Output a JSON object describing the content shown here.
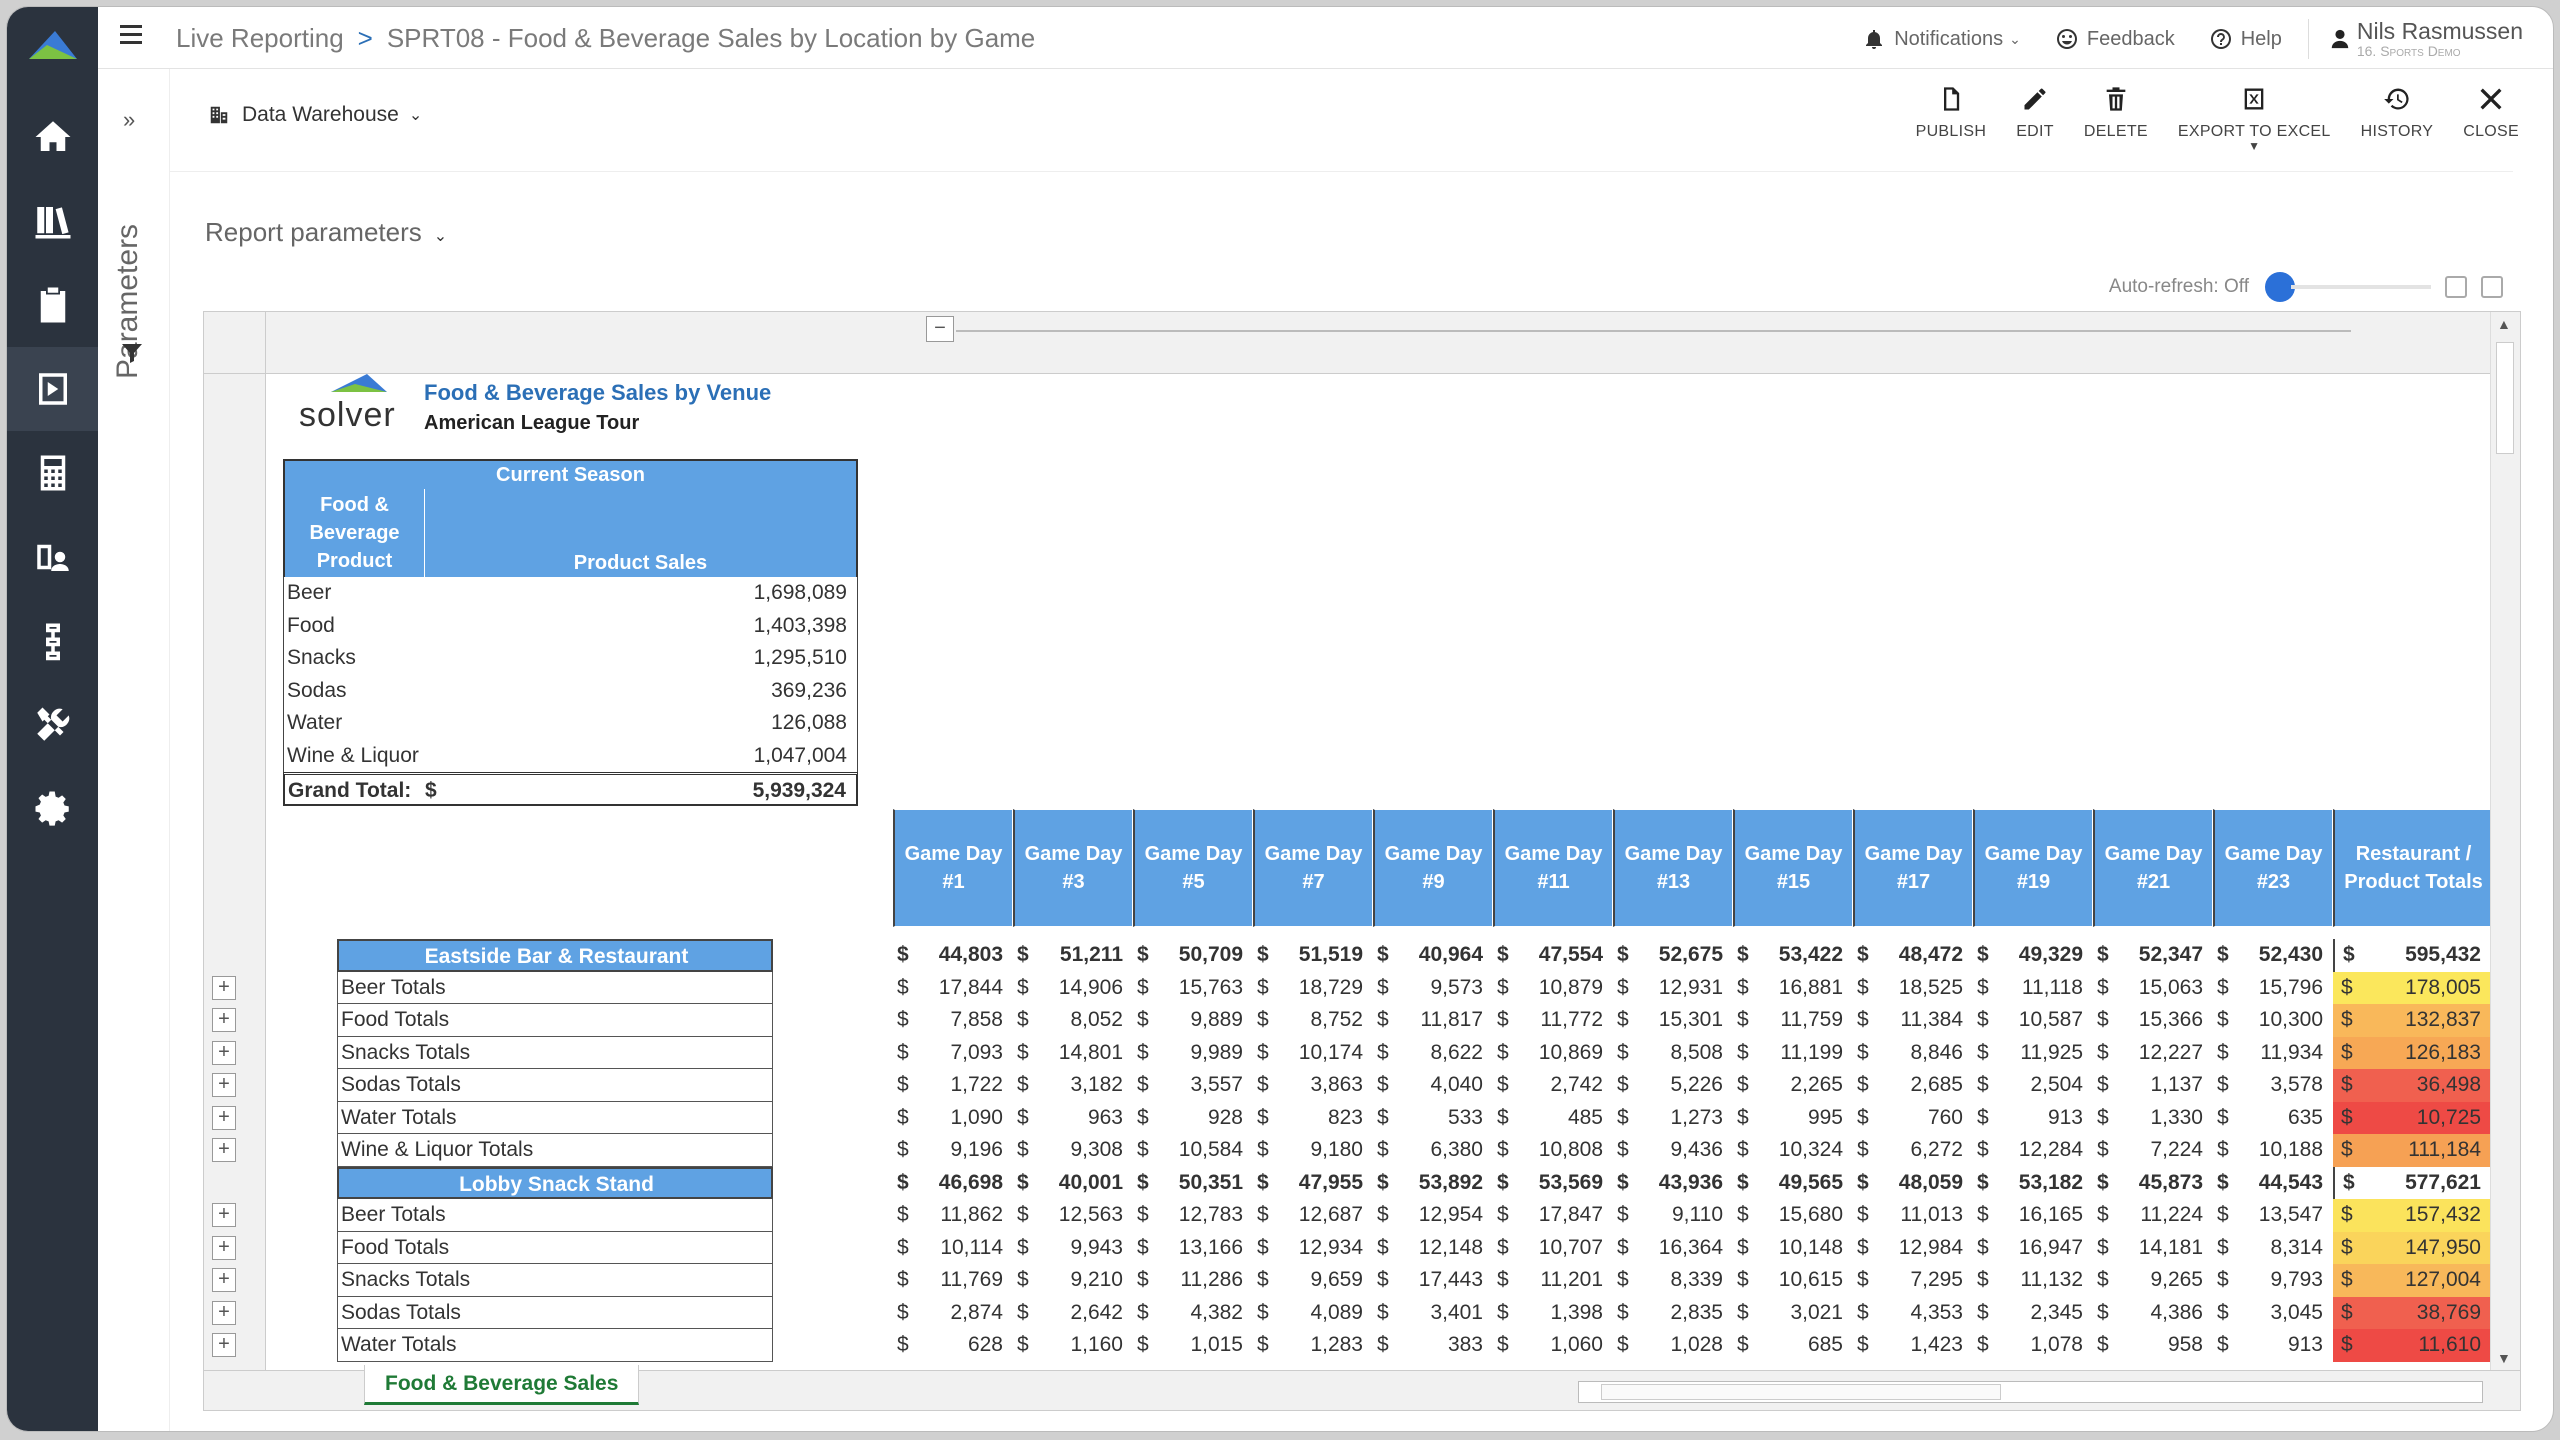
{
  "breadcrumb": {
    "root": "Live Reporting",
    "sep": ">",
    "current": "SPRT08 - Food & Beverage Sales by Location by Game"
  },
  "topbar": {
    "notifications": "Notifications",
    "feedback": "Feedback",
    "help": "Help",
    "user_name": "Nils Rasmussen",
    "user_org": "16. Sports Demo"
  },
  "param_panel": {
    "label": "Parameters",
    "expand": "»"
  },
  "data_source": {
    "label": "Data Warehouse"
  },
  "toolbar": {
    "publish": "PUBLISH",
    "edit": "EDIT",
    "delete": "DELETE",
    "export": "EXPORT TO EXCEL",
    "history": "HISTORY",
    "close": "CLOSE"
  },
  "report_params": {
    "label": "Report parameters"
  },
  "auto_refresh": {
    "label": "Auto-refresh: Off"
  },
  "report": {
    "logo_text": "solver",
    "title": "Food & Beverage Sales by Venue",
    "subtitle": "American League Tour",
    "season_header": "Current Season",
    "col_product": "Food & Beverage Product",
    "col_sales": "Product Sales",
    "products": [
      {
        "name": "Beer",
        "sales": "1,698,089"
      },
      {
        "name": "Food",
        "sales": "1,403,398"
      },
      {
        "name": "Snacks",
        "sales": "1,295,510"
      },
      {
        "name": "Sodas",
        "sales": "369,236"
      },
      {
        "name": "Water",
        "sales": "126,088"
      },
      {
        "name": "Wine & Liquor",
        "sales": "1,047,004"
      }
    ],
    "grand_total_label": "Grand Total:",
    "grand_total_currency": "$",
    "grand_total": "5,939,324",
    "game_days": [
      "Game Day #1",
      "Game Day #3",
      "Game Day #5",
      "Game Day #7",
      "Game Day #9",
      "Game Day #11",
      "Game Day #13",
      "Game Day #15",
      "Game Day #17",
      "Game Day #19",
      "Game Day #21",
      "Game Day #23"
    ],
    "totals_header": "Restaurant / Product Totals",
    "currency": "$",
    "venues": [
      {
        "name": "Eastside Bar & Restaurant",
        "values": [
          "44,803",
          "51,211",
          "50,709",
          "51,519",
          "40,964",
          "47,554",
          "52,675",
          "53,422",
          "48,472",
          "49,329",
          "52,347",
          "52,430"
        ],
        "total": "595,432",
        "rows": [
          {
            "label": "Beer Totals",
            "values": [
              "17,844",
              "14,906",
              "15,763",
              "18,729",
              "9,573",
              "10,879",
              "12,931",
              "16,881",
              "18,525",
              "11,118",
              "15,063",
              "15,796"
            ],
            "total": "178,005",
            "color": "#fbe75c"
          },
          {
            "label": "Food Totals",
            "values": [
              "7,858",
              "8,052",
              "9,889",
              "8,752",
              "11,817",
              "11,772",
              "15,301",
              "11,759",
              "11,384",
              "10,587",
              "15,366",
              "10,300"
            ],
            "total": "132,837",
            "color": "#f9b85a"
          },
          {
            "label": "Snacks Totals",
            "values": [
              "7,093",
              "14,801",
              "9,989",
              "10,174",
              "8,622",
              "10,869",
              "8,508",
              "11,199",
              "8,846",
              "11,925",
              "12,227",
              "11,934"
            ],
            "total": "126,183",
            "color": "#f7a855"
          },
          {
            "label": "Sodas Totals",
            "values": [
              "1,722",
              "3,182",
              "3,557",
              "3,863",
              "4,040",
              "2,742",
              "5,226",
              "2,265",
              "2,685",
              "2,504",
              "1,137",
              "3,578"
            ],
            "total": "36,498",
            "color": "#f0604f"
          },
          {
            "label": "Water Totals",
            "values": [
              "1,090",
              "963",
              "928",
              "823",
              "533",
              "485",
              "1,273",
              "995",
              "760",
              "913",
              "1,330",
              "635"
            ],
            "total": "10,725",
            "color": "#ee4a45"
          },
          {
            "label": "Wine & Liquor Totals",
            "values": [
              "9,196",
              "9,308",
              "10,584",
              "9,180",
              "6,380",
              "10,808",
              "9,436",
              "10,324",
              "6,272",
              "12,284",
              "7,224",
              "10,188"
            ],
            "total": "111,184",
            "color": "#f6a154"
          }
        ]
      },
      {
        "name": "Lobby Snack Stand",
        "values": [
          "46,698",
          "40,001",
          "50,351",
          "47,955",
          "53,892",
          "53,569",
          "43,936",
          "49,565",
          "48,059",
          "53,182",
          "45,873",
          "44,543"
        ],
        "total": "577,621",
        "rows": [
          {
            "label": "Beer Totals",
            "values": [
              "11,862",
              "12,563",
              "12,783",
              "12,687",
              "12,954",
              "17,847",
              "9,110",
              "15,680",
              "11,013",
              "16,165",
              "11,224",
              "13,547"
            ],
            "total": "157,432",
            "color": "#fbe35c"
          },
          {
            "label": "Food Totals",
            "values": [
              "10,114",
              "9,943",
              "13,166",
              "12,934",
              "12,148",
              "10,707",
              "16,364",
              "10,148",
              "12,984",
              "16,947",
              "14,181",
              "8,314"
            ],
            "total": "147,950",
            "color": "#fad45b"
          },
          {
            "label": "Snacks Totals",
            "values": [
              "11,769",
              "9,210",
              "11,286",
              "9,659",
              "17,443",
              "11,201",
              "8,339",
              "10,615",
              "7,295",
              "11,132",
              "9,265",
              "9,793"
            ],
            "total": "127,004",
            "color": "#f8b85a"
          },
          {
            "label": "Sodas Totals",
            "values": [
              "2,874",
              "2,642",
              "4,382",
              "4,089",
              "3,401",
              "1,398",
              "2,835",
              "3,021",
              "4,353",
              "2,345",
              "4,386",
              "3,045"
            ],
            "total": "38,769",
            "color": "#f0604f"
          },
          {
            "label": "Water Totals",
            "values": [
              "628",
              "1,160",
              "1,015",
              "1,283",
              "383",
              "1,060",
              "1,028",
              "685",
              "1,423",
              "1,078",
              "958",
              "913"
            ],
            "total": "11,610",
            "color": "#ee4a45"
          }
        ]
      }
    ]
  },
  "sheet_tab": "Food & Beverage Sales"
}
